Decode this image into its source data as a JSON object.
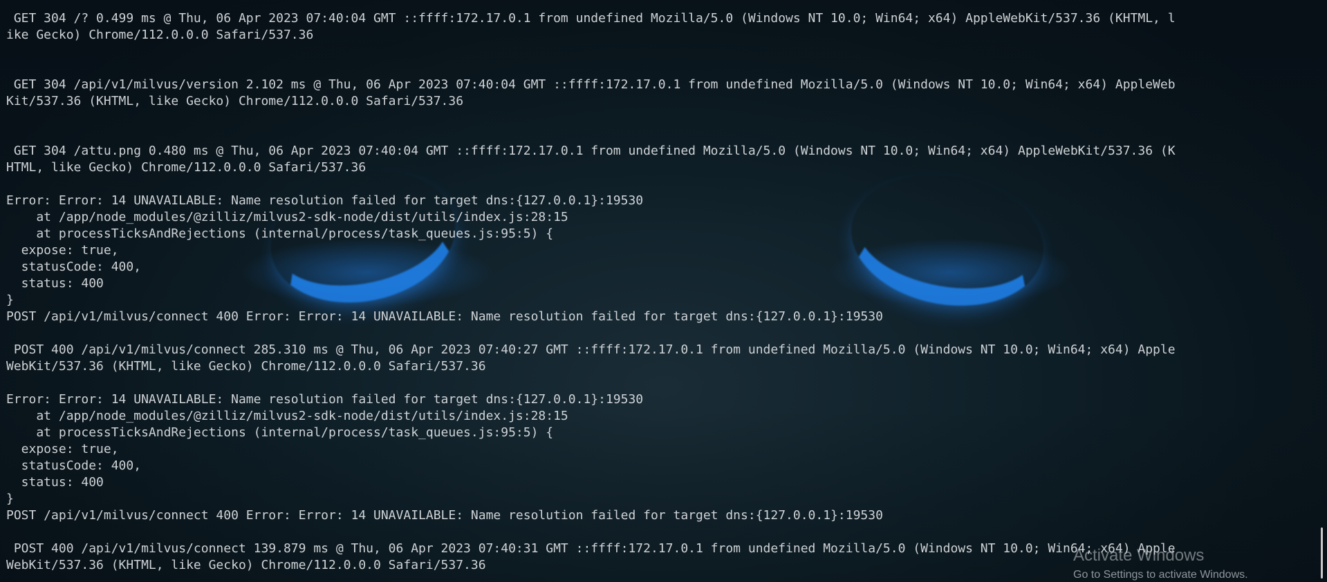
{
  "terminal": {
    "lines": [
      " GET 304 /? 0.499 ms @ Thu, 06 Apr 2023 07:40:04 GMT ::ffff:172.17.0.1 from undefined Mozilla/5.0 (Windows NT 10.0; Win64; x64) AppleWebKit/537.36 (KHTML, l",
      "ike Gecko) Chrome/112.0.0.0 Safari/537.36",
      "",
      "",
      " GET 304 /api/v1/milvus/version 2.102 ms @ Thu, 06 Apr 2023 07:40:04 GMT ::ffff:172.17.0.1 from undefined Mozilla/5.0 (Windows NT 10.0; Win64; x64) AppleWeb",
      "Kit/537.36 (KHTML, like Gecko) Chrome/112.0.0.0 Safari/537.36",
      "",
      "",
      " GET 304 /attu.png 0.480 ms @ Thu, 06 Apr 2023 07:40:04 GMT ::ffff:172.17.0.1 from undefined Mozilla/5.0 (Windows NT 10.0; Win64; x64) AppleWebKit/537.36 (K",
      "HTML, like Gecko) Chrome/112.0.0.0 Safari/537.36",
      "",
      "Error: Error: 14 UNAVAILABLE: Name resolution failed for target dns:{127.0.0.1}:19530",
      "    at /app/node_modules/@zilliz/milvus2-sdk-node/dist/utils/index.js:28:15",
      "    at processTicksAndRejections (internal/process/task_queues.js:95:5) {",
      "  expose: true,",
      "  statusCode: 400,",
      "  status: 400",
      "}",
      "POST /api/v1/milvus/connect 400 Error: Error: 14 UNAVAILABLE: Name resolution failed for target dns:{127.0.0.1}:19530",
      "",
      " POST 400 /api/v1/milvus/connect 285.310 ms @ Thu, 06 Apr 2023 07:40:27 GMT ::ffff:172.17.0.1 from undefined Mozilla/5.0 (Windows NT 10.0; Win64; x64) Apple",
      "WebKit/537.36 (KHTML, like Gecko) Chrome/112.0.0.0 Safari/537.36",
      "",
      "Error: Error: 14 UNAVAILABLE: Name resolution failed for target dns:{127.0.0.1}:19530",
      "    at /app/node_modules/@zilliz/milvus2-sdk-node/dist/utils/index.js:28:15",
      "    at processTicksAndRejections (internal/process/task_queues.js:95:5) {",
      "  expose: true,",
      "  statusCode: 400,",
      "  status: 400",
      "}",
      "POST /api/v1/milvus/connect 400 Error: Error: 14 UNAVAILABLE: Name resolution failed for target dns:{127.0.0.1}:19530",
      "",
      " POST 400 /api/v1/milvus/connect 139.879 ms @ Thu, 06 Apr 2023 07:40:31 GMT ::ffff:172.17.0.1 from undefined Mozilla/5.0 (Windows NT 10.0; Win64; x64) Apple",
      "WebKit/537.36 (KHTML, like Gecko) Chrome/112.0.0.0 Safari/537.36"
    ]
  },
  "watermark": {
    "title": "Activate Windows",
    "subtitle": "Go to Settings to activate Windows."
  },
  "theme": {
    "text_color": "#cfd3d6",
    "eye_glow": "#1f7fe6"
  }
}
